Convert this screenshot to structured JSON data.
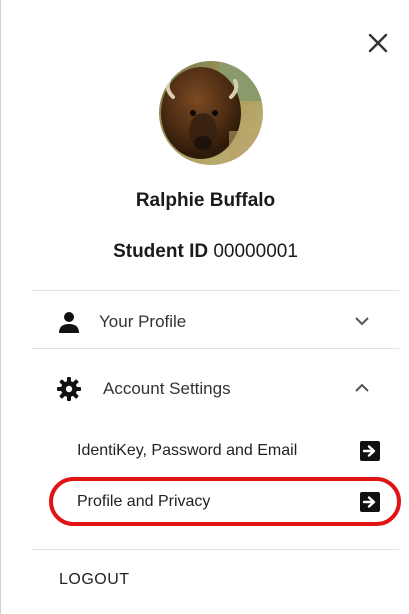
{
  "header": {
    "close_icon": "close-icon"
  },
  "profile": {
    "name": "Ralphie Buffalo",
    "student_id_label": "Student ID",
    "student_id_value": "00000001"
  },
  "menu": {
    "your_profile": {
      "label": "Your Profile",
      "icon": "person-icon",
      "expanded": false
    },
    "account_settings": {
      "label": "Account Settings",
      "icon": "gear-icon",
      "expanded": true,
      "items": [
        {
          "label": "IdentiKey, Password and Email",
          "icon": "arrow-right-box-icon"
        },
        {
          "label": "Profile and Privacy",
          "icon": "arrow-right-box-icon",
          "highlighted": true
        }
      ]
    },
    "logout_label": "LOGOUT"
  },
  "colors": {
    "highlight": "#e11313",
    "text": "#222222",
    "divider": "#e2e2e2"
  }
}
